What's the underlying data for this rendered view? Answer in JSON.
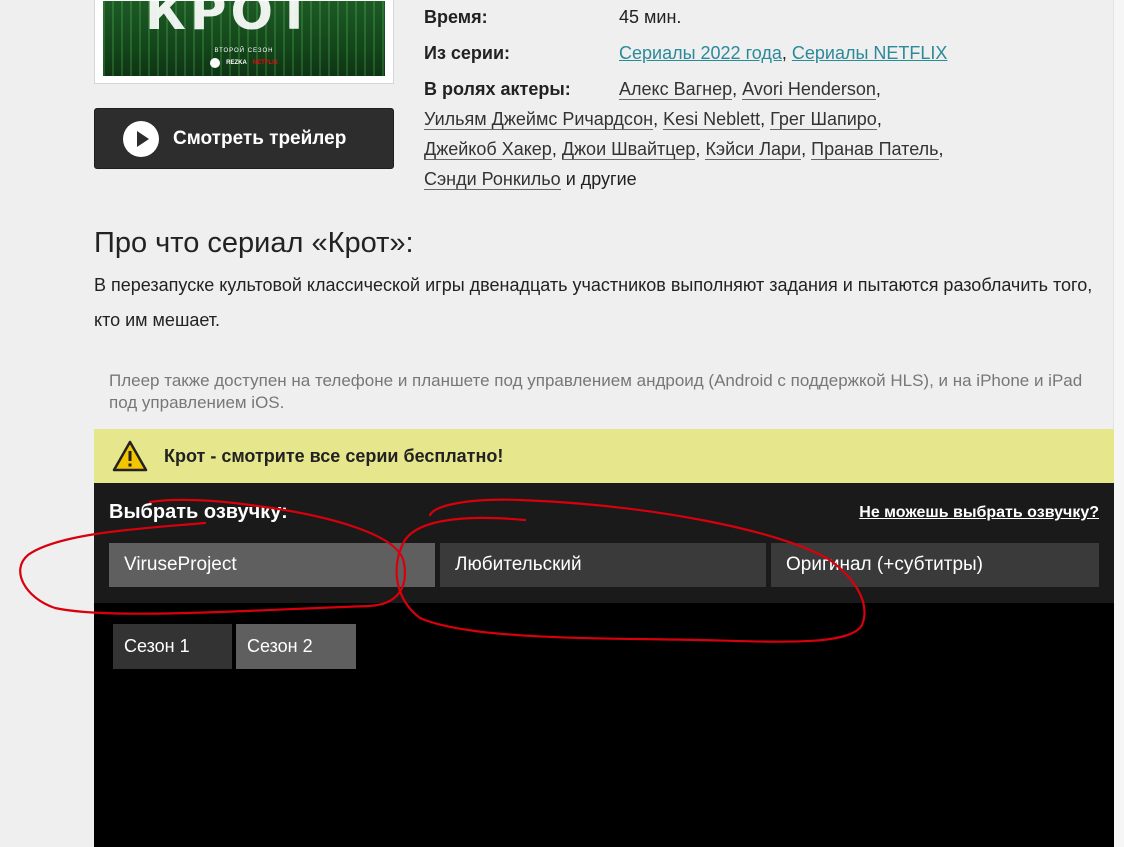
{
  "poster": {
    "title": "КРОТ",
    "season_text": "ВТОРОЙ СЕЗОН",
    "logo_hdrezka": "REZKA",
    "logo_netflix": "NETFLIX"
  },
  "trailer": {
    "label": "Смотреть трейлер"
  },
  "info": {
    "time_label": "Время:",
    "time_value": "45 мин.",
    "series_label": "Из серии:",
    "series_link_1": "Сериалы 2022 года",
    "series_link_2": "Сериалы NETFLIX",
    "actors_label": "В ролях актеры:",
    "actors": [
      "Алекс Вагнер",
      "Avori Henderson",
      "Уильям Джеймс Ричардсон",
      "Kesi Neblett",
      "Грег Шапиро",
      "Джейкоб Хакер",
      "Джои Швайтцер",
      "Кэйси Лари",
      "Пранав Патель",
      "Сэнди Ронкильо"
    ],
    "actors_more": "и другие"
  },
  "about": {
    "title": "Про что сериал «Крот»:",
    "text": "В перезапуске культовой классической игры двенадцать участников выполняют задания и пытаются разоблачить того, кто им мешает."
  },
  "player_note": "Плеер также доступен на телефоне и планшете под управлением андроид (Android с поддержкой HLS), и на iPhone и iPad под управлением iOS.",
  "warning": {
    "text": "Крот - смотрите все серии бесплатно!"
  },
  "translators": {
    "title": "Выбрать озвучку:",
    "help_link": "Не можешь выбрать озвучку?",
    "options": [
      {
        "label": "ViruseProject",
        "active": true
      },
      {
        "label": "Любительский",
        "active": false
      },
      {
        "label": "Оригинал (+субтитры)",
        "active": false
      }
    ]
  },
  "seasons": [
    {
      "label": "Сезон 1"
    },
    {
      "label": "Сезон 2"
    }
  ],
  "colors": {
    "link": "#2a8a9a",
    "warning_bg": "#e6e68c",
    "annotation": "#d8000c"
  }
}
